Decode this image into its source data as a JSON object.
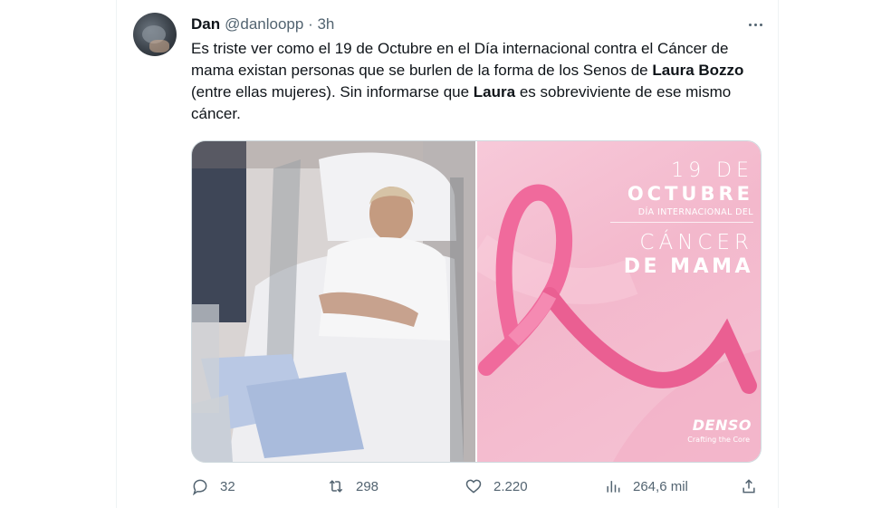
{
  "tweet": {
    "author_name": "Dan",
    "handle_time": "@danloopp · 3h",
    "text_part1": "Es triste ver como el 19 de Octubre en el Día internacional contra el Cáncer de mama existan personas que se burlen de la forma de los Senos de ",
    "text_bold1": "Laura Bozzo",
    "text_part2": " (entre ellas mujeres). Sin informarse que ",
    "text_bold2": "Laura",
    "text_part3": " es sobreviviente de ese mismo cáncer."
  },
  "poster": {
    "line1": "19 DE",
    "line2": "OCTUBRE",
    "line3": "DÍA INTERNACIONAL DEL",
    "line4": "CÁNCER",
    "line5": "DE MAMA",
    "brand": "DENSO",
    "brand_tagline": "Crafting the Core",
    "ribbon_color": "#f06a9c"
  },
  "actions": {
    "replies": "32",
    "retweets": "298",
    "likes": "2.220",
    "views": "264,6 mil"
  },
  "icons": [
    "reply-icon",
    "retweet-icon",
    "like-icon",
    "views-icon",
    "share-icon",
    "more-icon"
  ]
}
